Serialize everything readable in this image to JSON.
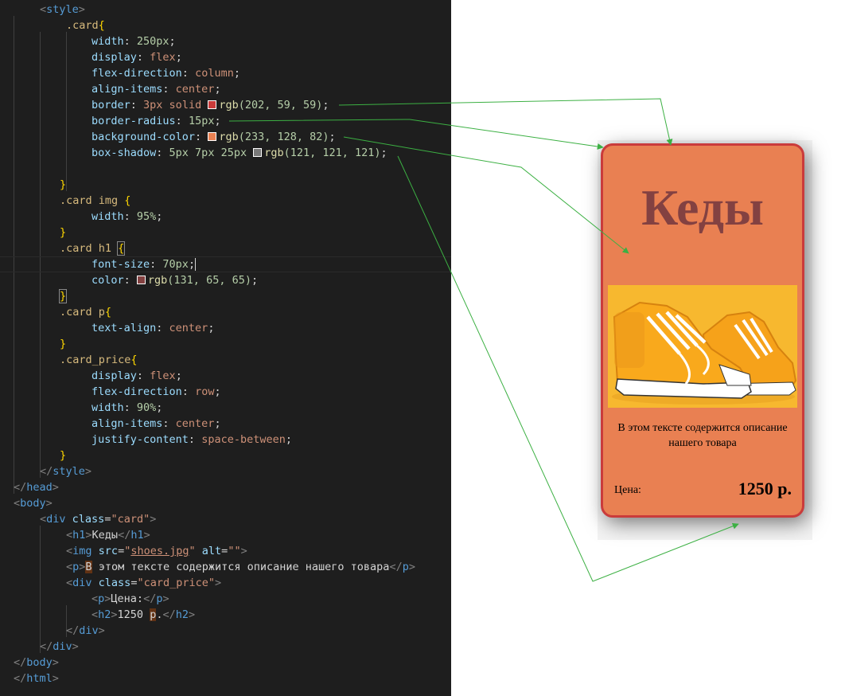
{
  "code": {
    "style_open": "style",
    "card_selector": ".card",
    "card_width_prop": "width",
    "card_width_val": "250px",
    "display_prop": "display",
    "display_val": "flex",
    "flexdir_prop": "flex-direction",
    "flexdir_val": "column",
    "align_prop": "align-items",
    "align_val": "center",
    "border_prop": "border",
    "border_val_a": "3px solid",
    "border_rgb": "rgb",
    "border_nums": "(202, 59, 59)",
    "radius_prop": "border-radius",
    "radius_val": "15px",
    "bg_prop": "background-color",
    "bg_rgb": "rgb",
    "bg_nums": "(233, 128, 82)",
    "shadow_prop": "box-shadow",
    "shadow_val_a": "5px 7px 25px",
    "shadow_rgb": "rgb",
    "shadow_nums": "(121, 121, 121)",
    "img_selector": ".card img",
    "img_width_prop": "width",
    "img_width_val": "95%",
    "h1_selector": ".card h1",
    "fontsize_prop": "font-size",
    "fontsize_val": "70px",
    "color_prop": "color",
    "color_rgb": "rgb",
    "color_nums": "(131, 65, 65)",
    "p_selector": ".card p",
    "textalign_prop": "text-align",
    "textalign_val": "center",
    "price_selector": ".card_price",
    "price_display_prop": "display",
    "price_display_val": "flex",
    "price_flexdir_prop": "flex-direction",
    "price_flexdir_val": "row",
    "price_width_prop": "width",
    "price_width_val": "90%",
    "price_align_prop": "align-items",
    "price_align_val": "center",
    "justify_prop": "justify-content",
    "justify_val": "space-between",
    "style_close": "style",
    "head_close": "head",
    "body_open": "body",
    "div_tag": "div",
    "class_attr": "class",
    "card_class_str": "\"card\"",
    "h1_tag": "h1",
    "h1_text": "Кеды",
    "img_tag": "img",
    "src_attr": "src",
    "src_val": "shoes.jpg",
    "alt_attr": "alt",
    "alt_val": "\"\"",
    "p_tag": "p",
    "p_text_first": "В",
    "p_text_rest": " этом тексте содержится описание нашего товара",
    "price_class_str": "\"card_price\"",
    "price_label_text": "Цена:",
    "h2_tag": "h2",
    "h2_text_a": "1250 ",
    "h2_text_b": "р",
    "h2_text_c": ".",
    "body_close": "body",
    "html_close": "html"
  },
  "colors": {
    "border": "#ca3b3b",
    "background": "#e98052",
    "shadow": "#797979",
    "title": "#834141",
    "arrow": "#3cb043"
  },
  "preview": {
    "title": "Кеды",
    "image_alt": "sneakers-photo",
    "description": "В этом тексте содержится описание нашего товара",
    "price_label": "Цена:",
    "price_value": "1250 р."
  }
}
